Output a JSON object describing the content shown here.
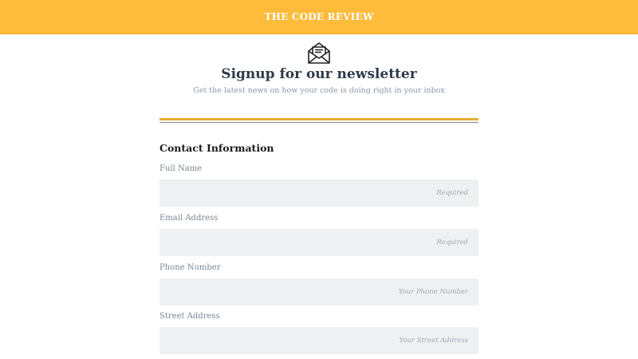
{
  "header": {
    "brand": "THE CODE REVIEW"
  },
  "hero": {
    "icon": "open-envelope-icon",
    "title": "Signup for our newsletter",
    "subtitle": "Get the latest news on how your code is doing right in your inbox"
  },
  "colors": {
    "topbar": "#FFBB3A",
    "divider_accent": "#E5AC34",
    "input_bg": "#EEF0F2"
  },
  "form": {
    "section_title": "Contact Information",
    "fields": [
      {
        "label": "Full Name",
        "placeholder": "Required"
      },
      {
        "label": "Email Address",
        "placeholder": "Required"
      },
      {
        "label": "Phone Number",
        "placeholder": "Your Phone Number"
      },
      {
        "label": "Street Address",
        "placeholder": "Your Street Address"
      }
    ]
  }
}
